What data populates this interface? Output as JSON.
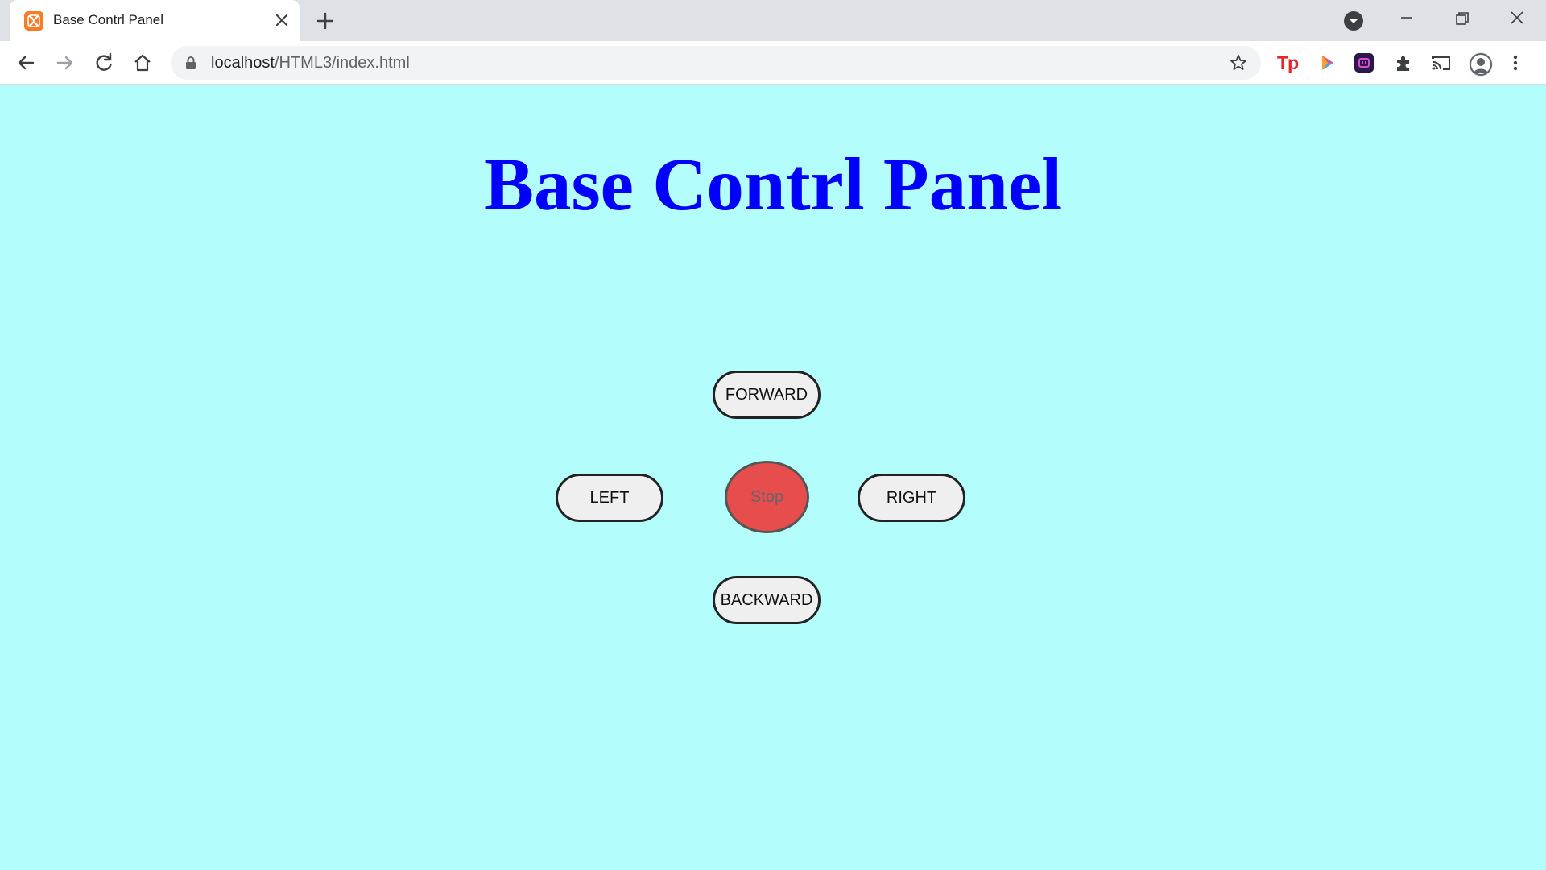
{
  "browser": {
    "tab": {
      "title": "Base Contrl Panel"
    },
    "address": {
      "host": "localhost",
      "path": "/HTML3/index.html"
    }
  },
  "page": {
    "title": "Base Contrl Panel",
    "background_color": "#b3fdfc",
    "title_color": "#0000ff",
    "controls": {
      "forward": "FORWARD",
      "left": "LEFT",
      "stop": "Stop",
      "right": "RIGHT",
      "backward": "BACKWARD"
    },
    "stop_color": "#e84d4d"
  },
  "icons": {
    "favicon": "xampp-icon",
    "close": "close-icon",
    "new_tab": "plus-icon",
    "back": "back-arrow-icon",
    "forward": "forward-arrow-icon",
    "reload": "reload-icon",
    "home": "home-icon",
    "lock": "lock-icon",
    "bookmark": "star-icon",
    "extensions": "puzzle-icon",
    "cast": "cast-icon",
    "profile": "avatar-icon",
    "menu": "kebab-menu-icon"
  }
}
